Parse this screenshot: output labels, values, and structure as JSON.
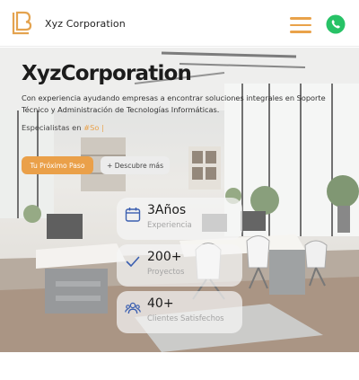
{
  "header": {
    "brand": "Xyz Corporation",
    "logo_icon": "lb-monogram-logo",
    "menu_icon": "hamburger-menu-icon",
    "whatsapp_icon": "whatsapp-icon",
    "accent_color": "#e9a24a",
    "whatsapp_color": "#27c266"
  },
  "hero": {
    "title": "XyzCorporation",
    "description": "Con experiencia ayudando empresas a encontrar soluciones integrales en Soporte Técnico y Administración de Tecnologías Informáticas.",
    "tag_prefix": "Especialistas en ",
    "tag_accent": "#So |",
    "cta_primary": "Tu Próximo Paso",
    "cta_secondary": "+ Descubre más",
    "stats": [
      {
        "icon": "calendar-icon",
        "value": "3Años",
        "label": "Experiencia"
      },
      {
        "icon": "check-icon",
        "value": "200+",
        "label": "Proyectos"
      },
      {
        "icon": "users-icon",
        "value": "40+",
        "label": "Clientes Satisfechos"
      }
    ]
  }
}
